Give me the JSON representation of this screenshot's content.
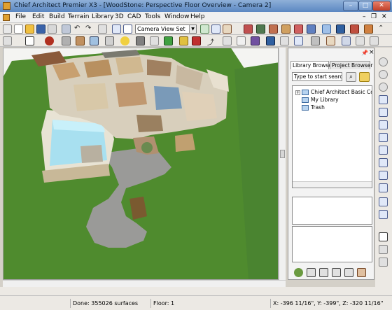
{
  "window": {
    "title": "Chief Architect Premier X3 - [WoodStone: Perspective Floor Overview - Camera 2]",
    "min_glyph": "–",
    "max_glyph": "□",
    "close_glyph": "✕"
  },
  "menu": {
    "items": [
      "File",
      "Edit",
      "Build",
      "Terrain",
      "Library",
      "3D",
      "CAD",
      "Tools",
      "Window",
      "Help"
    ],
    "mdi_controls": [
      "–",
      "❐",
      "✕"
    ]
  },
  "toolbar": {
    "camera_set": "Camera View Set"
  },
  "library": {
    "tabs": [
      "Library Browser",
      "Project Browser"
    ],
    "search_placeholder": "Type to start searchir",
    "tree": [
      {
        "label": "Chief Architect Basic Cor",
        "expandable": true
      },
      {
        "label": "My Library",
        "expandable": false
      },
      {
        "label": "Trash",
        "expandable": false
      }
    ],
    "close_glyph": "×",
    "pin_glyph": "📌"
  },
  "status": {
    "done": "Done:  355026 surfaces",
    "floor": "Floor: 1",
    "coords": "X: -396 11/16\", Y: -399\", Z: -320 11/16\""
  },
  "colors": {
    "grass": "#4f8b2e",
    "driveway": "#9a9a98",
    "pool": "#a8e0f0",
    "title_bar": "#6f95c8"
  }
}
